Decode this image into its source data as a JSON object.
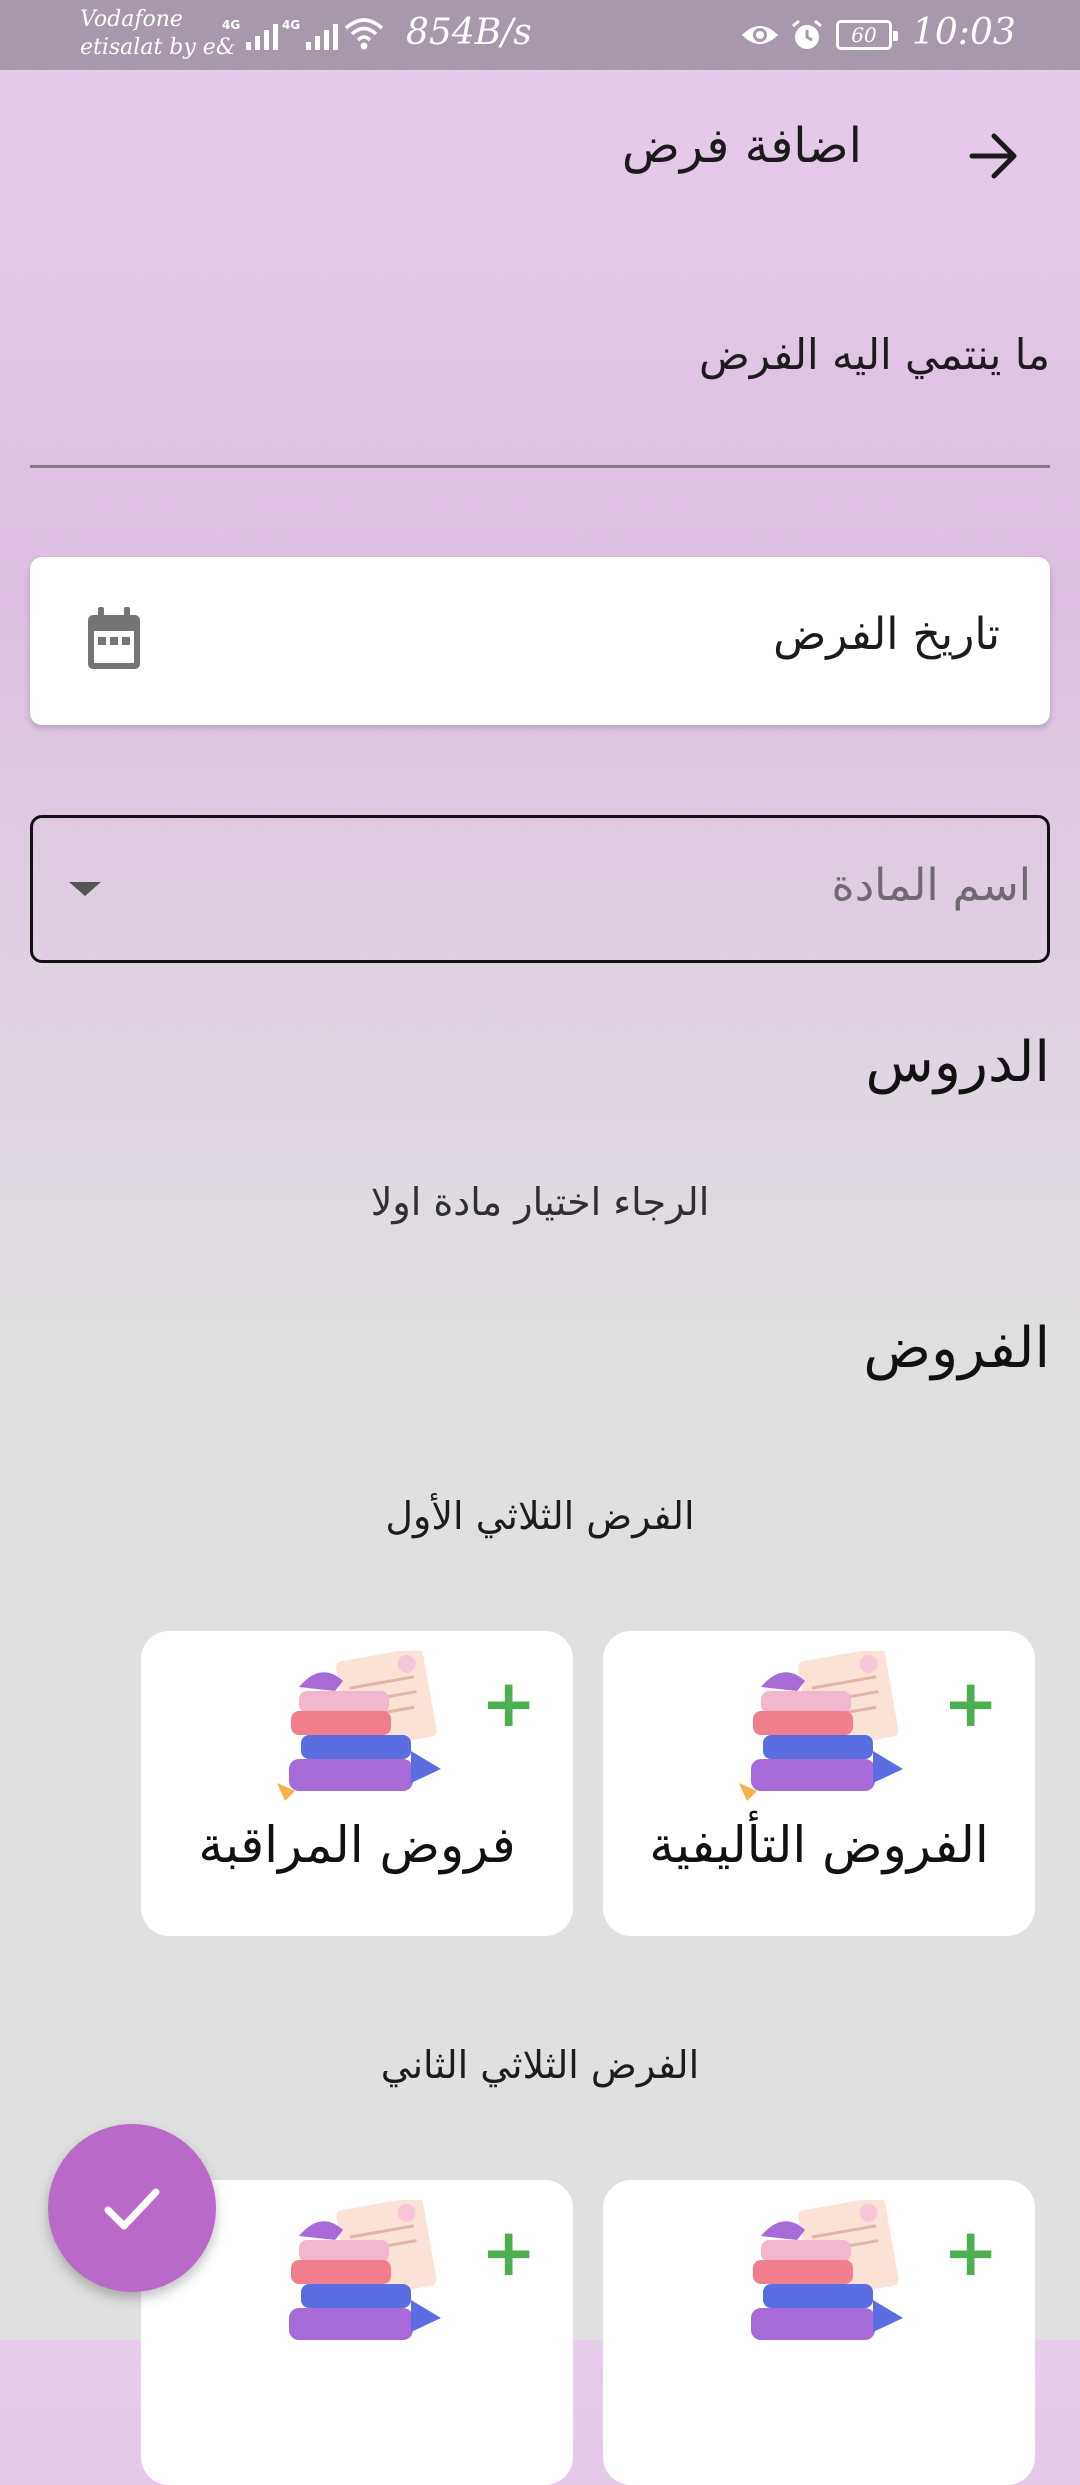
{
  "status_bar": {
    "carrier_line1": "Vodafone",
    "carrier_line2": "etisalat by e&",
    "network_tag": "4G",
    "net_speed": "854B/s",
    "battery": "60",
    "time": "10:03",
    "icons": [
      "signal-icon",
      "wifi-icon",
      "eye-icon",
      "alarm-icon",
      "battery-icon"
    ]
  },
  "header": {
    "title": "اضافة فرض",
    "back_icon": "arrow-right-icon"
  },
  "form": {
    "parent_label": "ما ينتمي اليه الفرض",
    "date_label": "تاريخ الفرض",
    "date_icon": "calendar-icon",
    "subject_placeholder": "اسم المادة",
    "subject_icon": "caret-down-icon"
  },
  "lessons": {
    "heading": "الدروس",
    "empty_message": "الرجاء اختيار مادة اولا"
  },
  "exams": {
    "heading": "الفروض",
    "terms": [
      {
        "title": "الفرض الثلاثي الأول",
        "cards": [
          {
            "label": "الفروض التأليفية",
            "action": "+"
          },
          {
            "label": "فروض المراقبة",
            "action": "+"
          }
        ]
      },
      {
        "title": "الفرض الثلاثي الثاني",
        "cards": [
          {
            "label": "",
            "action": "+"
          },
          {
            "label": "",
            "action": "+"
          }
        ]
      }
    ]
  },
  "fab": {
    "icon": "check-icon"
  },
  "colors": {
    "accent": "#b96ac9",
    "plus": "#4caf50",
    "status_bar": "#a898ab"
  }
}
